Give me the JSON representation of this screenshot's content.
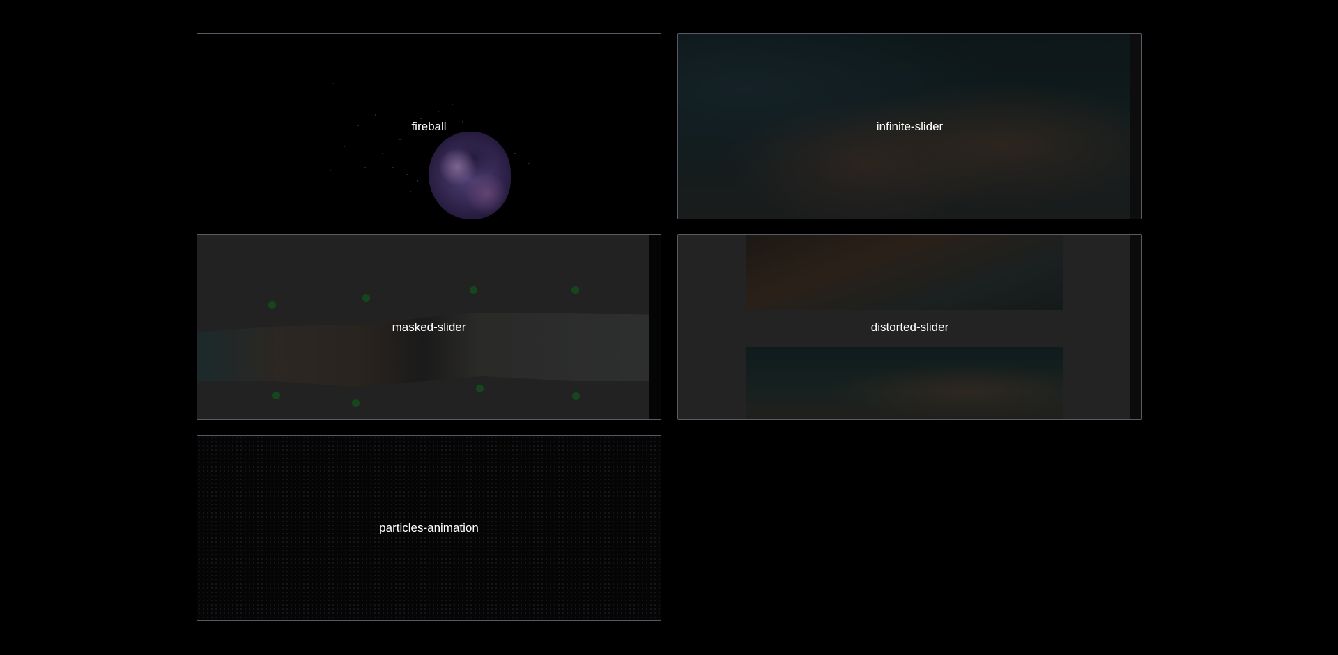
{
  "cards": [
    {
      "id": "fireball",
      "label": "fireball"
    },
    {
      "id": "infinite-slider",
      "label": "infinite-slider"
    },
    {
      "id": "masked-slider",
      "label": "masked-slider"
    },
    {
      "id": "distorted-slider",
      "label": "distorted-slider"
    },
    {
      "id": "particles-animation",
      "label": "particles-animation"
    }
  ],
  "colors": {
    "page_background": "#000000",
    "card_border": "#5a5a66",
    "label_text": "#ffffff"
  }
}
